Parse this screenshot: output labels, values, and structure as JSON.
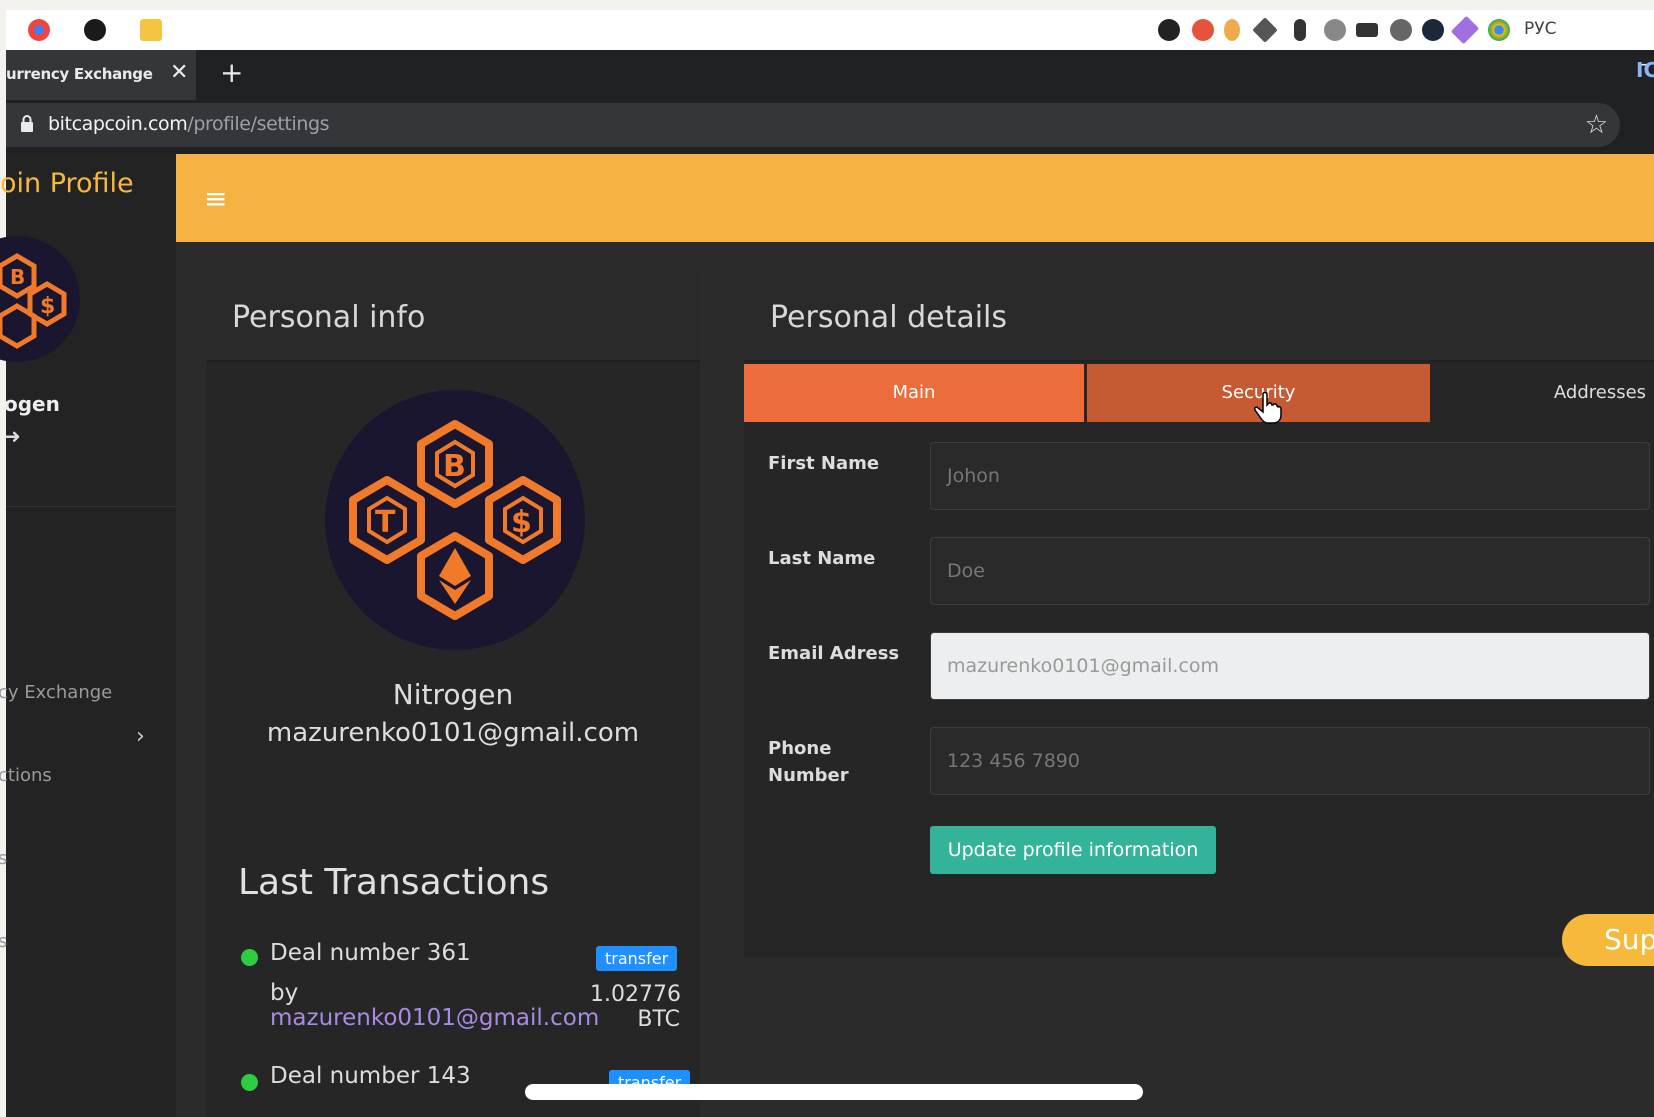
{
  "system_tray": {
    "language": "РУС"
  },
  "browser": {
    "tab_title": "urrency Exchange",
    "tab_close": "✕",
    "new_tab": "+",
    "minimize": "–",
    "url_host": "bitcapcoin.com",
    "url_path": "/profile/settings",
    "bookmark_star": "☆",
    "extension_label": "IC"
  },
  "sidebar": {
    "title": "oin Profile",
    "user_name": "ogen",
    "logout_icon": "➜",
    "items": [
      {
        "label": "cy Exchange"
      },
      {
        "label": "ctions"
      },
      {
        "label": "s"
      },
      {
        "label": "s"
      }
    ],
    "chevron": "›"
  },
  "topbar": {
    "menu_icon": "≡",
    "color": "#f3b242"
  },
  "personal_info": {
    "title": "Personal info",
    "name": "Nitrogen",
    "email": "mazurenko0101@gmail.com",
    "last_transactions_title": "Last Transactions",
    "transactions": [
      {
        "deal": "Deal number 361",
        "badge": "transfer",
        "by": "by",
        "by_email": "mazurenko0101@gmail.com",
        "amount": "1.02776",
        "currency": "BTC"
      },
      {
        "deal": "Deal number 143",
        "badge": "transfer"
      }
    ]
  },
  "personal_details": {
    "title": "Personal details",
    "tabs": [
      {
        "label": "Main",
        "active": true
      },
      {
        "label": "Security",
        "hover": true
      },
      {
        "label": "Addresses"
      }
    ],
    "fields": [
      {
        "label": "First Name",
        "placeholder": "Johon"
      },
      {
        "label": "Last Name",
        "placeholder": "Doe"
      },
      {
        "label": "Email Adress",
        "value": "mazurenko0101@gmail.com"
      },
      {
        "label_line1": "Phone",
        "label_line2": "Number",
        "placeholder": "123 456 7890"
      }
    ],
    "update_button": "Update profile information"
  },
  "support_button": "Sup",
  "colors": {
    "accent_orange": "#ec6d3b",
    "tab_hover": "#c65a33",
    "update_green": "#34b39b",
    "badge_blue": "#1e90ff"
  }
}
